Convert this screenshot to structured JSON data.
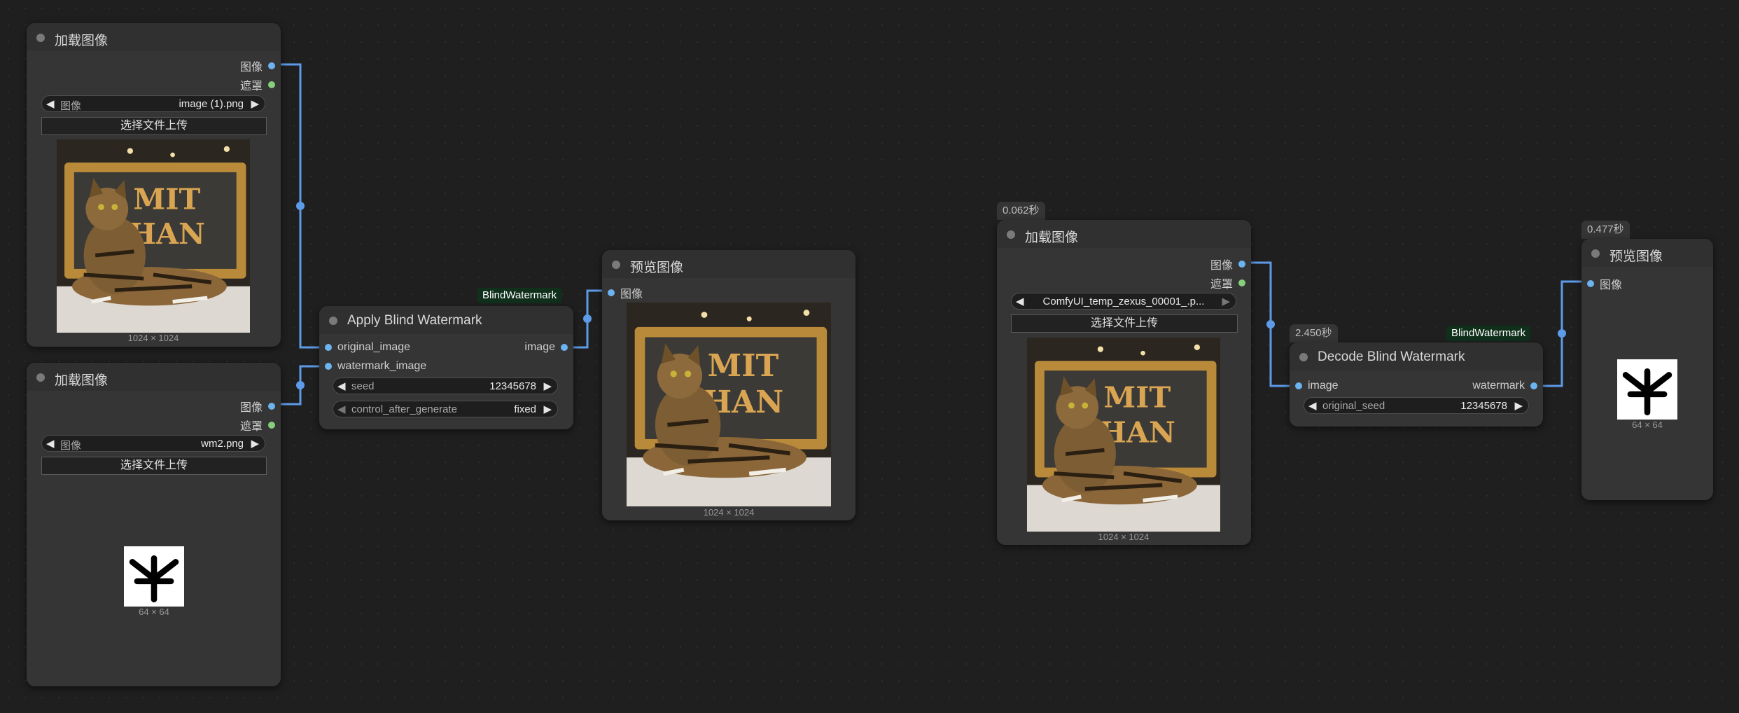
{
  "slot_colors": {
    "image": "#6cb4f0",
    "mask": "#86cf7b",
    "wire": "#5d9be8"
  },
  "load_image_1": {
    "title": "加载图像",
    "out_image": "图像",
    "out_mask": "遮罩",
    "widget_label": "图像",
    "widget_value": "image (1).png",
    "upload_label": "选择文件上传",
    "dims": "1024 × 1024"
  },
  "load_image_2": {
    "title": "加载图像",
    "out_image": "图像",
    "out_mask": "遮罩",
    "widget_label": "图像",
    "widget_value": "wm2.png",
    "upload_label": "选择文件上传",
    "dims": "64 × 64"
  },
  "apply_blind_watermark": {
    "tag": "BlindWatermark",
    "title": "Apply Blind Watermark",
    "in_original": "original_image",
    "in_watermark": "watermark_image",
    "out_image": "image",
    "seed_label": "seed",
    "seed_value": "12345678",
    "control_label": "control_after_generate",
    "control_value": "fixed"
  },
  "preview_image_1": {
    "title": "预览图像",
    "in_image": "图像",
    "dims": "1024 × 1024"
  },
  "load_image_3": {
    "time": "0.062秒",
    "title": "加载图像",
    "out_image": "图像",
    "out_mask": "遮罩",
    "widget_value": "ComfyUI_temp_zexus_00001_.p...",
    "upload_label": "选择文件上传",
    "dims": "1024 × 1024"
  },
  "decode_blind_watermark": {
    "time": "2.450秒",
    "tag": "BlindWatermark",
    "title": "Decode Blind Watermark",
    "in_image": "image",
    "out_watermark": "watermark",
    "seed_label": "original_seed",
    "seed_value": "12345678"
  },
  "preview_image_2": {
    "time": "0.477秒",
    "title": "预览图像",
    "in_image": "图像",
    "dims": "64 × 64"
  },
  "thumbnail_plaque_text": [
    "MIT",
    "HAN"
  ]
}
